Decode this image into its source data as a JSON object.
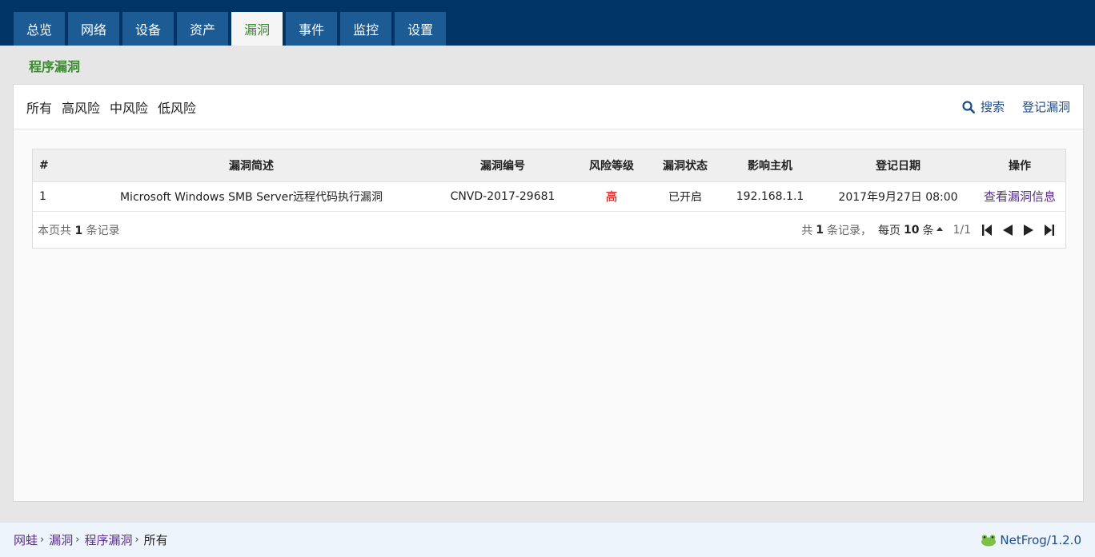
{
  "nav": {
    "tabs": [
      {
        "label": "总览",
        "active": false
      },
      {
        "label": "网络",
        "active": false
      },
      {
        "label": "设备",
        "active": false
      },
      {
        "label": "资产",
        "active": false
      },
      {
        "label": "漏洞",
        "active": true
      },
      {
        "label": "事件",
        "active": false
      },
      {
        "label": "监控",
        "active": false
      },
      {
        "label": "设置",
        "active": false
      }
    ]
  },
  "section_title": "程序漏洞",
  "filters": {
    "items": [
      "所有",
      "高风险",
      "中风险",
      "低风险"
    ],
    "search_label": "搜索",
    "register_label": "登记漏洞"
  },
  "table": {
    "headers": [
      "#",
      "漏洞简述",
      "漏洞编号",
      "风险等级",
      "漏洞状态",
      "影响主机",
      "登记日期",
      "操作"
    ],
    "rows": [
      {
        "num": "1",
        "desc": "Microsoft Windows SMB Server远程代码执行漏洞",
        "id": "CNVD-2017-29681",
        "risk": "高",
        "status": "已开启",
        "host": "192.168.1.1",
        "date": "2017年9月27日 08:00",
        "action": "查看漏洞信息"
      }
    ]
  },
  "table_footer": {
    "page_prefix": "本页共",
    "page_count": "1",
    "page_suffix": "条记录",
    "total_prefix": "共",
    "total_count": "1",
    "total_suffix": "条记录，",
    "per_prefix": "每页",
    "per_count": "10",
    "per_suffix": "条",
    "page_indicator": "1/1"
  },
  "breadcrumb": {
    "items": [
      "网蛙",
      "漏洞",
      "程序漏洞"
    ],
    "current": "所有",
    "separator": "›"
  },
  "brand": {
    "label": "NetFrog/1.2.0"
  },
  "colors": {
    "nav_bg": "#003366",
    "tab_bg": "#1d5b94",
    "active_tab_text": "#3a8a2e",
    "risk_high": "#cc1111",
    "link": "#5a2d8c"
  }
}
